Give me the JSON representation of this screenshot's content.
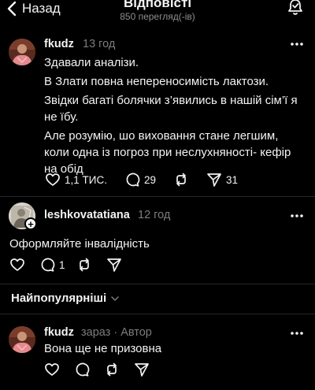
{
  "header": {
    "back_label": "Назад",
    "title": "Відповісті",
    "subtitle": "850 перегляд(-ів)"
  },
  "main_post": {
    "username": "fkudz",
    "time": "13 год",
    "lines": [
      "Здавали аналізи.",
      "В Злати повна непереносимість лактози.",
      "Звідки багаті болячки з’явились в нашій сім’ї я не їбу.",
      "Але розумію, шо виховання стане легшим, коли одна із погроз при неслухняності- кефір на обід"
    ],
    "likes": "1,1 ТИС.",
    "comments": "29",
    "reposts": "",
    "shares": "31"
  },
  "reply_1": {
    "username": "leshkovatatiana",
    "time": "12 год",
    "text": "Оформляйте інвалідність",
    "likes": "",
    "comments": "1"
  },
  "sort": {
    "label": "Найпопулярніші"
  },
  "reply_2": {
    "username": "fkudz",
    "time": "зараз · Автор",
    "text": "Вона ще не призовна"
  },
  "colors": {
    "background": "#000000",
    "text": "#f3f3f3",
    "muted": "#7c7c7c",
    "divider": "#262626"
  }
}
